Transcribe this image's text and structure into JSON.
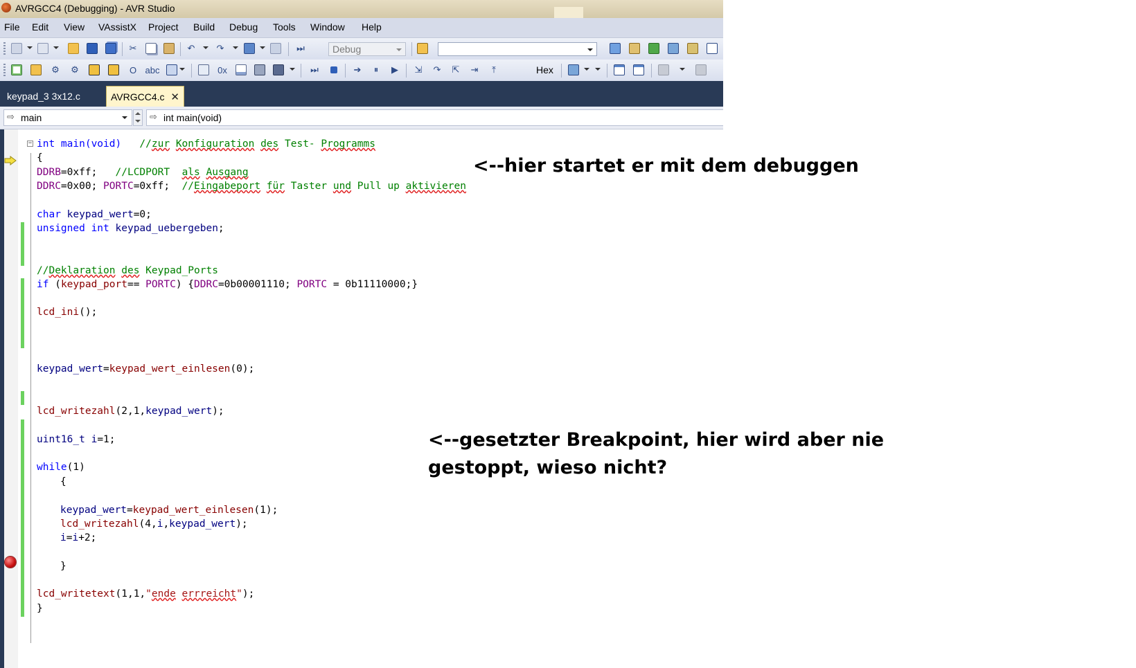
{
  "window": {
    "title": "AVRGCC4 (Debugging) - AVR Studio"
  },
  "menu": [
    "File",
    "Edit",
    "View",
    "VAssistX",
    "Project",
    "Build",
    "Debug",
    "Tools",
    "Window",
    "Help"
  ],
  "toolbar": {
    "configuration": "Debug",
    "find_value": "",
    "hex_label": "Hex"
  },
  "tabs": [
    {
      "label": "keypad_3 3x12.c",
      "active": false
    },
    {
      "label": "AVRGCC4.c",
      "active": true,
      "close_glyph": "✕"
    }
  ],
  "navigation": {
    "scope": "main",
    "member": "int main(void)"
  },
  "code": {
    "l01_sig": "int main(void)",
    "l01_c1": "//",
    "l01_c2": "zur",
    "l01_c3": "Konfiguration",
    "l01_c4": "des",
    "l01_c5": "Test-",
    "l01_c6": "Programms",
    "l02": "{",
    "l03_mac": "DDRB",
    "l03_val": "=0xff;",
    "l03_c1": "//LCDPORT",
    "l03_c2": "als",
    "l03_c3": "Ausgang",
    "l04_m1": "DDRC",
    "l04_v1": "=0x00;",
    "l04_m2": "PORTC",
    "l04_v2": "=0xff;",
    "l04_c1": "//",
    "l04_c2": "Eingabeport",
    "l04_c3": "für",
    "l04_c4": "Taster",
    "l04_c5": "und",
    "l04_c6": "Pull up",
    "l04_c7": "aktivieren",
    "l06_kw": "char",
    "l06_var": "keypad_wert",
    "l06_rest": "=0;",
    "l07_kw1": "unsigned",
    "l07_kw2": "int",
    "l07_var": "keypad_uebergeben",
    "l07_rest": ";",
    "l10_c1": "//",
    "l10_c2": "Deklaration",
    "l10_c3": "des",
    "l10_c4": "Keypad_Ports",
    "l11_kw": "if",
    "l11_p1": " (",
    "l11_fn": "keypad_port",
    "l11_p2": "== ",
    "l11_m1": "PORTC",
    "l11_p3": ") {",
    "l11_m2": "DDRC",
    "l11_p4": "=0b00001110; ",
    "l11_m3": "PORTC",
    "l11_p5": " = 0b11110000;}",
    "l13_fn": "lcd_ini",
    "l13_rest": "();",
    "l17_var": "keypad_wert",
    "l17_eq": "=",
    "l17_fn": "keypad_wert_einlesen",
    "l17_rest": "(0);",
    "l20_fn": "lcd_writezahl",
    "l20_p1": "(2,1,",
    "l20_var": "keypad_wert",
    "l20_p2": ");",
    "l22_type": "uint16_t",
    "l22_var": "i",
    "l22_rest": "=1;",
    "l24_kw": "while",
    "l24_rest": "(1)",
    "l25": "{",
    "l27_var": "keypad_wert",
    "l27_eq": "=",
    "l27_fn": "keypad_wert_einlesen",
    "l27_rest": "(1);",
    "l28_fn": "lcd_writezahl",
    "l28_p1": "(4,",
    "l28_i": "i",
    "l28_p2": ",",
    "l28_var": "keypad_wert",
    "l28_p3": ");",
    "l29_v1": "i",
    "l29_eq": "=",
    "l29_v2": "i",
    "l29_rest": "+2;",
    "l31": "}",
    "l33_fn": "lcd_writetext",
    "l33_p1": "(1,1,",
    "l33_s1": "\"",
    "l33_s2": "ende",
    "l33_s3": " ",
    "l33_s4": "errreicht",
    "l33_s5": "\"",
    "l33_p2": ");",
    "l34": "}"
  },
  "annotations": {
    "debug_start": "<--hier startet er mit dem debuggen",
    "breakpoint_line1": "<--gesetzter Breakpoint, hier wird aber nie",
    "breakpoint_line2": "gestoppt, wieso nicht?"
  },
  "colors": {
    "keyword": "#0000ff",
    "function": "#880000",
    "variable": "#000080",
    "macro": "#800080",
    "comment": "#008000",
    "string": "#a31515",
    "change_bar": "#6cd25f",
    "tabstrip": "#293a56",
    "active_tab": "#fff5cc"
  },
  "icons": [
    "app-icon",
    "new-project-icon",
    "add-item-icon",
    "open-icon",
    "save-icon",
    "save-all-icon",
    "cut-icon",
    "copy-icon",
    "paste-icon",
    "undo-icon",
    "redo-icon",
    "navigate-icon",
    "build-icon",
    "find-in-files-icon",
    "step-over-icon",
    "stop-debugging-icon",
    "show-next-statement-icon",
    "break-all-icon",
    "run-icon",
    "step-into-icon",
    "step-out-icon",
    "execution-pointer-icon",
    "breakpoint-icon"
  ]
}
